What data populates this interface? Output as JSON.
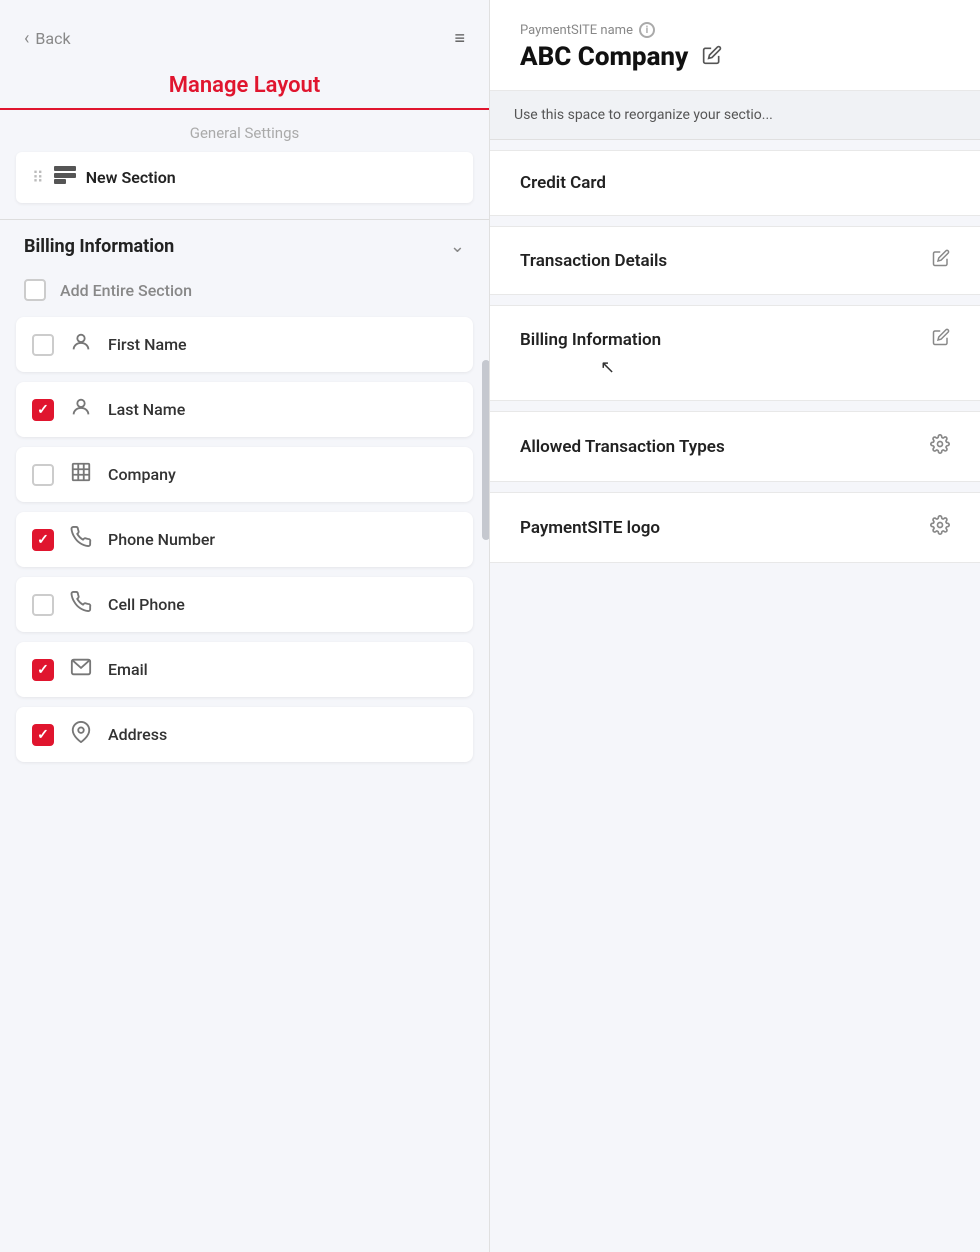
{
  "left": {
    "back_label": "Back",
    "menu_icon": "≡",
    "title": "Manage Layout",
    "general_settings": "General Settings",
    "new_section": {
      "label": "New Section"
    },
    "billing": {
      "title": "Billing Information",
      "add_entire_section": "Add Entire Section",
      "fields": [
        {
          "id": "first-name",
          "label": "First Name",
          "checked": false,
          "icon": "person"
        },
        {
          "id": "last-name",
          "label": "Last Name",
          "checked": true,
          "icon": "person"
        },
        {
          "id": "company",
          "label": "Company",
          "checked": false,
          "icon": "building"
        },
        {
          "id": "phone-number",
          "label": "Phone Number",
          "checked": true,
          "icon": "phone"
        },
        {
          "id": "cell-phone",
          "label": "Cell Phone",
          "checked": false,
          "icon": "phone"
        },
        {
          "id": "email",
          "label": "Email",
          "checked": true,
          "icon": "email"
        },
        {
          "id": "address",
          "label": "Address",
          "checked": true,
          "icon": "location"
        }
      ]
    }
  },
  "right": {
    "payment_site_label": "PaymentSITE name",
    "info_icon": "i",
    "company_name": "ABC Company",
    "info_banner": "Use this space to reorganize your sectio...",
    "sections": [
      {
        "id": "credit-card",
        "label": "Credit Card",
        "icon_type": "none"
      },
      {
        "id": "transaction-details",
        "label": "Transaction Details",
        "icon_type": "edit"
      },
      {
        "id": "billing-information",
        "label": "Billing Information",
        "icon_type": "edit"
      },
      {
        "id": "allowed-transaction-types",
        "label": "Allowed Transaction Types",
        "icon_type": "gear"
      },
      {
        "id": "paymentsite-logo",
        "label": "PaymentSITE logo",
        "icon_type": "gear"
      }
    ]
  }
}
